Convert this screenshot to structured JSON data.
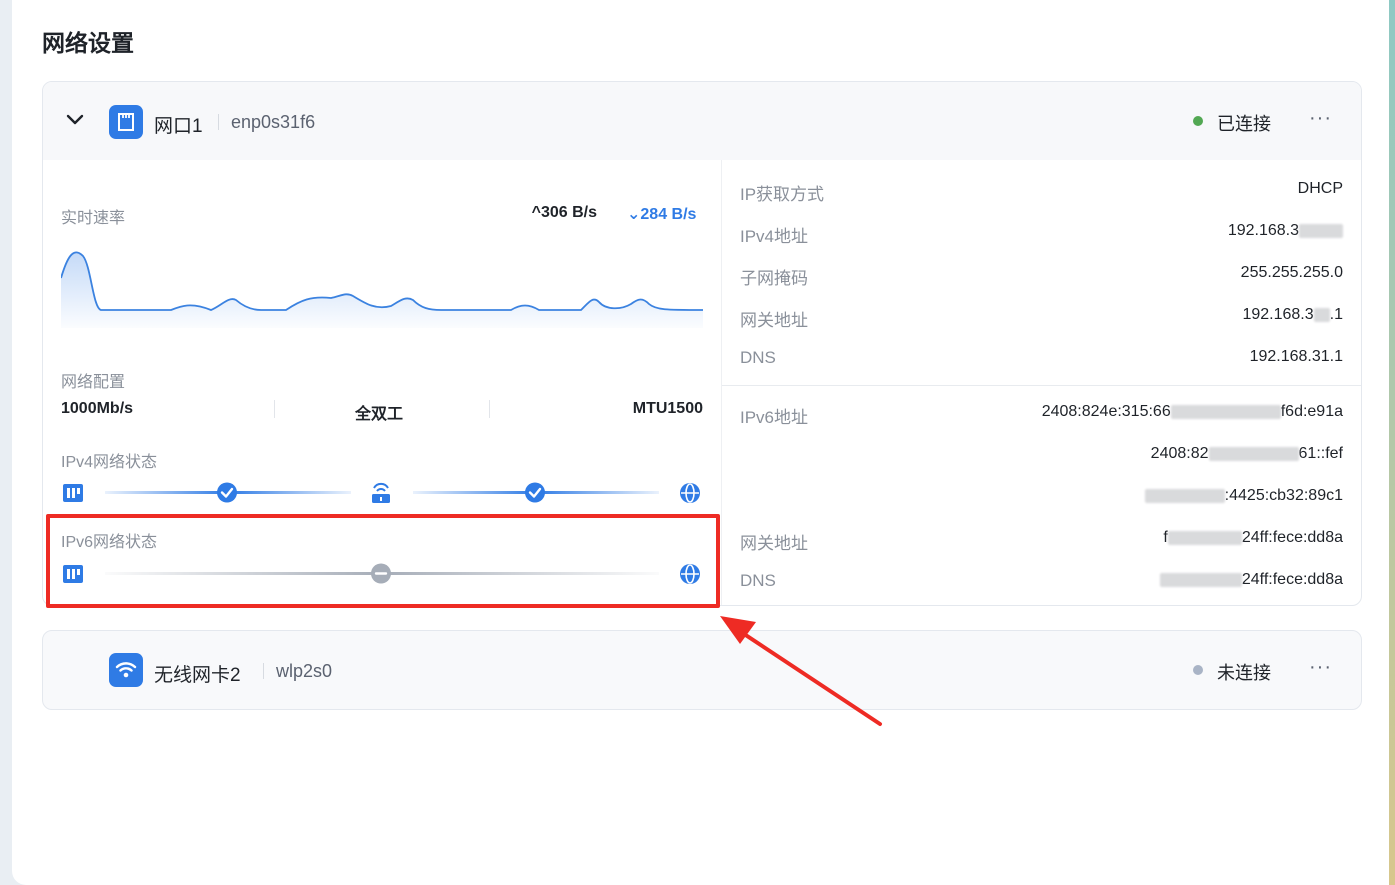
{
  "page": {
    "title": "网络设置"
  },
  "interfaces": [
    {
      "name": "网口1",
      "device": "enp0s31f6",
      "status": "已连接",
      "status_color": "#52a853",
      "icon": "ethernet-port-icon",
      "more_label": "···",
      "speed": {
        "label": "实时速率",
        "up": "306 B/s",
        "down": "284 B/s"
      },
      "config": {
        "label": "网络配置",
        "bandwidth": "1000Mb/s",
        "duplex": "全双工",
        "mtu": "MTU1500"
      },
      "ipv4_state": {
        "label": "IPv4网络状态",
        "links": [
          "ok",
          "ok"
        ]
      },
      "ipv6_state": {
        "label": "IPv6网络状态",
        "links": [
          "disconnected"
        ]
      },
      "details": {
        "ip_method": {
          "label": "IP获取方式",
          "value": "DHCP"
        },
        "ipv4": {
          "label": "IPv4地址",
          "value": "192.168.3"
        },
        "netmask": {
          "label": "子网掩码",
          "value": "255.255.255.0"
        },
        "gateway": {
          "label": "网关地址",
          "value_a": "192.168.3",
          "value_b": ".1"
        },
        "dns": {
          "label": "DNS",
          "value": "192.168.31.1"
        },
        "ipv6": {
          "label": "IPv6地址",
          "line1_a": "2408:824e:315:66",
          "line1_b": "f6d:e91a",
          "line2_a": "2408:82",
          "line2_b": "61::fef",
          "line3": ":4425:cb32:89c1"
        },
        "ipv6_gateway": {
          "label": "网关地址",
          "value_a": "f",
          "value_b": "24ff:fece:dd8a"
        },
        "ipv6_dns": {
          "label": "DNS",
          "value": "24ff:fece:dd8a"
        }
      }
    },
    {
      "name": "无线网卡2",
      "device": "wlp2s0",
      "status": "未连接",
      "status_color": "#a9b4c6",
      "icon": "wifi-icon",
      "more_label": "···"
    }
  ]
}
